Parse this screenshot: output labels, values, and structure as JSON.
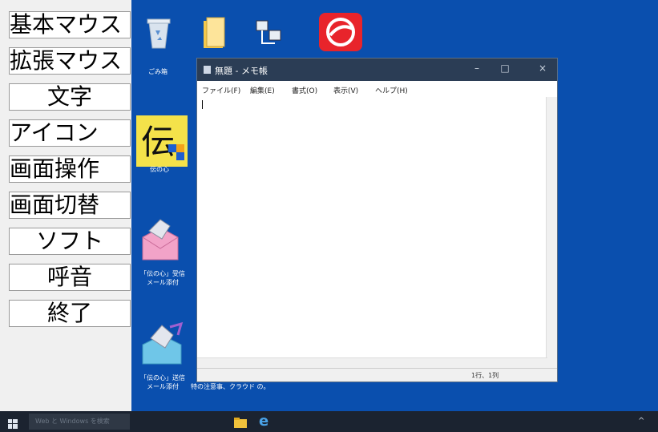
{
  "side_menu": {
    "items": [
      "基本マウス",
      "拡張マウス",
      "文字",
      "アイコン",
      "画面操作",
      "画面切替",
      "ソフト",
      "呼音",
      "終了"
    ]
  },
  "desktop": {
    "icons": [
      {
        "label": "ごみ箱",
        "icon": "recycle-bin-icon"
      },
      {
        "label": "",
        "icon": "folder-icon"
      },
      {
        "label": "",
        "icon": "network-app-icon"
      },
      {
        "label": "",
        "icon": "security-app-icon"
      },
      {
        "label": "伝の心",
        "icon": "den-no-shin-icon"
      },
      {
        "label_line1": "「伝の心」受信",
        "label_line2": "メール添付",
        "icon": "mail-receive-icon"
      },
      {
        "label_line1": "「伝の心」送信",
        "label_line2": "メール添付",
        "icon": "mail-send-icon"
      }
    ],
    "partial_label": "特の注意事、クラウド  の。"
  },
  "notepad": {
    "title": "無題 - メモ帳",
    "controls": {
      "minimize": "–",
      "maximize": "□",
      "close": "×"
    },
    "menus": [
      "ファイル(F)",
      "編集(E)",
      "書式(O)",
      "表示(V)",
      "ヘルプ(H)"
    ],
    "status_position": "1行、1列"
  },
  "taskbar": {
    "search_placeholder": "Web と Windows を検索"
  }
}
